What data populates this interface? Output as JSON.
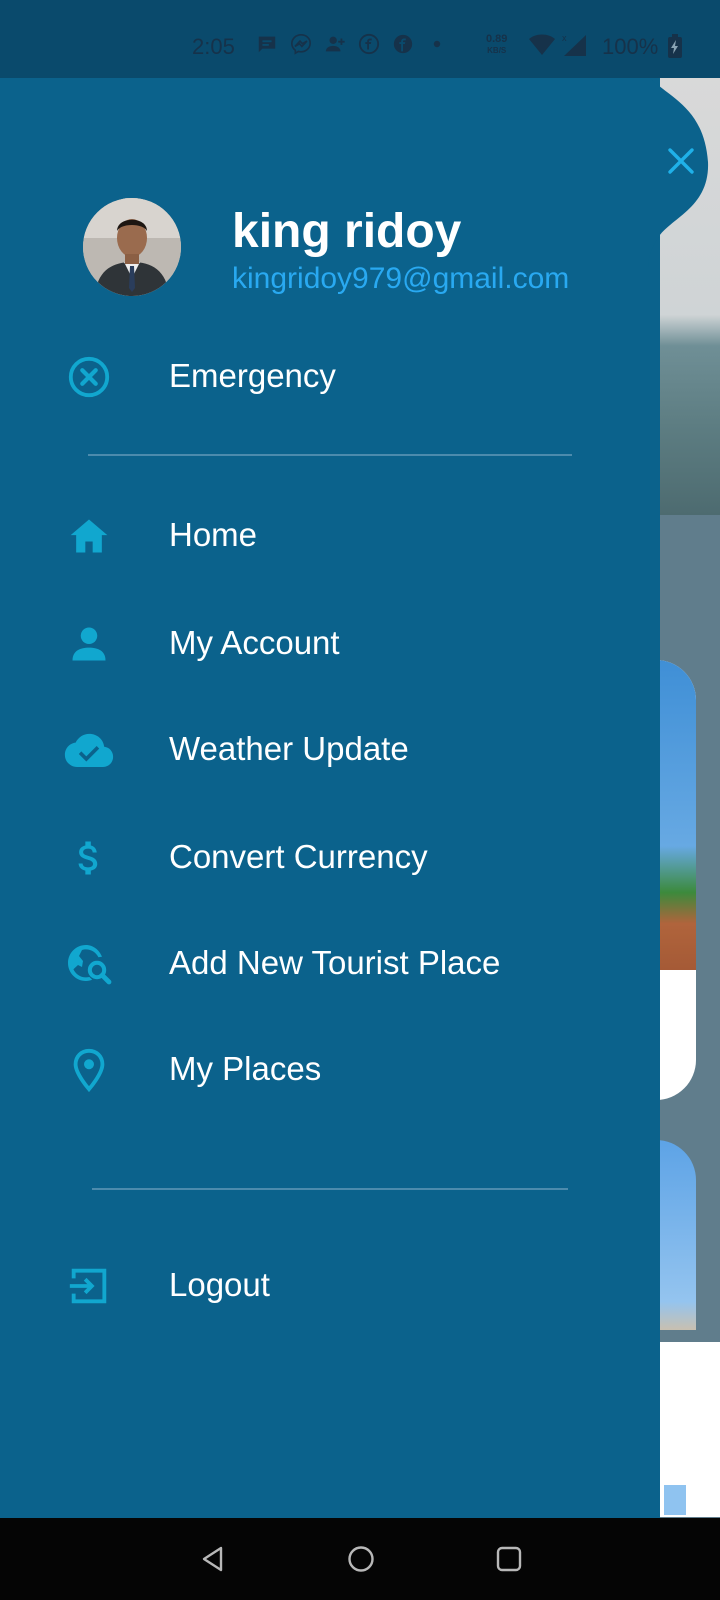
{
  "status_bar": {
    "time": "2:05",
    "speed_value": "0.89",
    "speed_unit": "KB/S",
    "battery": "100%"
  },
  "drawer": {
    "user": {
      "name": "king ridoy",
      "email": "kingridoy979@gmail.com"
    },
    "emergency_label": "Emergency",
    "items": [
      {
        "label": "Home",
        "icon": "home-icon"
      },
      {
        "label": "My Account",
        "icon": "person-icon"
      },
      {
        "label": "Weather Update",
        "icon": "cloud-check-icon"
      },
      {
        "label": "Convert Currency",
        "icon": "dollar-icon"
      },
      {
        "label": "Add New Tourist Place",
        "icon": "travel-explore-icon"
      },
      {
        "label": "My Places",
        "icon": "location-pin-icon"
      }
    ],
    "logout_label": "Logout"
  },
  "colors": {
    "drawer_bg": "#0b628c",
    "accent": "#11a7cf",
    "email": "#29a9f1",
    "status_bar": "#0a4a6c"
  }
}
